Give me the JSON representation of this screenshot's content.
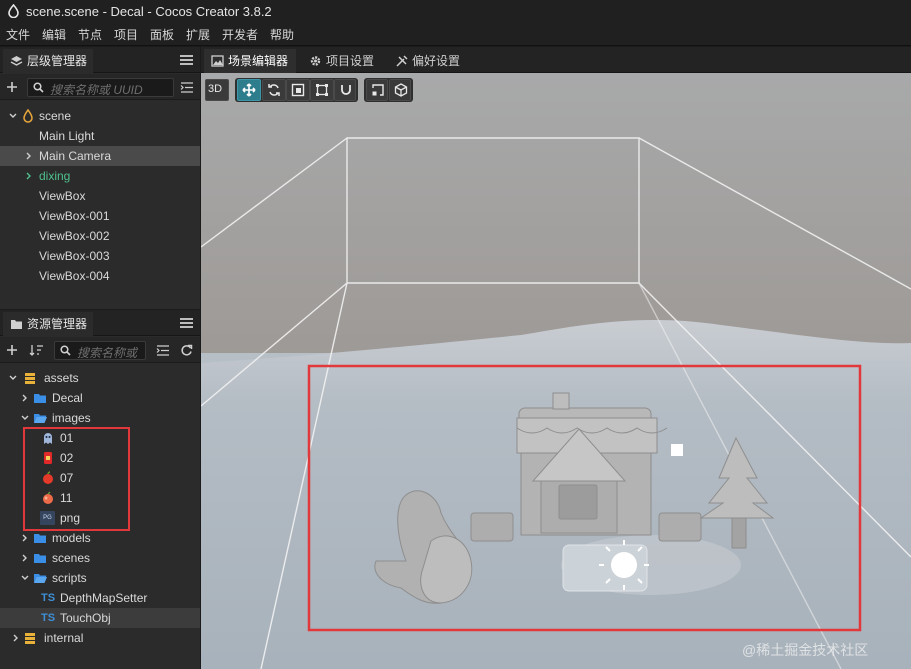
{
  "window": {
    "title": "scene.scene - Decal - Cocos Creator 3.8.2"
  },
  "menu": [
    "文件",
    "编辑",
    "节点",
    "项目",
    "面板",
    "扩展",
    "开发者",
    "帮助"
  ],
  "hierarchy": {
    "tab_label": "层级管理器",
    "search_placeholder": "搜索名称或 UUID",
    "items": [
      {
        "label": "scene"
      },
      {
        "label": "Main Light"
      },
      {
        "label": "Main Camera"
      },
      {
        "label": "dixing"
      },
      {
        "label": "ViewBox"
      },
      {
        "label": "ViewBox-001"
      },
      {
        "label": "ViewBox-002"
      },
      {
        "label": "ViewBox-003"
      },
      {
        "label": "ViewBox-004"
      }
    ]
  },
  "assets": {
    "tab_label": "资源管理器",
    "search_placeholder": "搜索名称或",
    "items": [
      {
        "label": "assets"
      },
      {
        "label": "Decal"
      },
      {
        "label": "images"
      },
      {
        "label": "01"
      },
      {
        "label": "02"
      },
      {
        "label": "07"
      },
      {
        "label": "11"
      },
      {
        "label": "png"
      },
      {
        "label": "models"
      },
      {
        "label": "scenes"
      },
      {
        "label": "scripts"
      },
      {
        "label": "DepthMapSetter"
      },
      {
        "label": "TouchObj"
      },
      {
        "label": "internal"
      }
    ],
    "script_badge": "TS",
    "png_badge": "PG"
  },
  "main_tabs": [
    {
      "label": "场景编辑器"
    },
    {
      "label": "项目设置"
    },
    {
      "label": "偏好设置"
    }
  ],
  "scene_toolbar": {
    "mode_3d": "3D"
  },
  "watermark": "@稀土掘金技术社区",
  "colors": {
    "accent": "#2e7d8c",
    "highlight_box": "#e0383b",
    "dixing_text": "#4fc08d",
    "folder": "#3a8ee6",
    "wall_top": "#9a8f8c",
    "floor": "#a8b2bb"
  }
}
